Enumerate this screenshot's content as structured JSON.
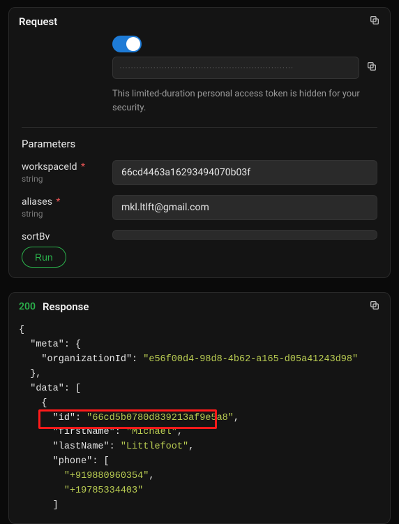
{
  "request": {
    "title": "Request",
    "token": {
      "masked_value": "••••••••••••••••••••••••••••••••••••••••••••••••••••••••••••••",
      "hint": "This limited-duration personal access token is hidden for your security."
    },
    "parametersTitle": "Parameters",
    "params": {
      "workspaceId": {
        "label": "workspaceId",
        "type": "string",
        "required": true,
        "value": "66cd4463a16293494070b03f"
      },
      "aliases": {
        "label": "aliases",
        "type": "string",
        "required": true,
        "value": "mkl.ltlft@gmail.com"
      },
      "sortBy": {
        "label": "sortBy",
        "type": "",
        "required": false,
        "value": ""
      }
    },
    "runLabel": "Run"
  },
  "response": {
    "status": "200",
    "title": "Response",
    "body": {
      "meta": {
        "organizationId": "e56f00d4-98d8-4b62-a165-d05a41243d98"
      },
      "data": [
        {
          "id": "66cd5b0780d839213af9e5a8",
          "firstName": "Michael",
          "lastName": "Littlefoot",
          "phone": [
            "+919880960354",
            "+19785334403"
          ]
        }
      ]
    },
    "keys": {
      "meta": "meta",
      "organizationId": "organizationId",
      "data": "data",
      "id": "id",
      "firstName": "firstName",
      "lastName": "lastName",
      "phone": "phone"
    }
  }
}
